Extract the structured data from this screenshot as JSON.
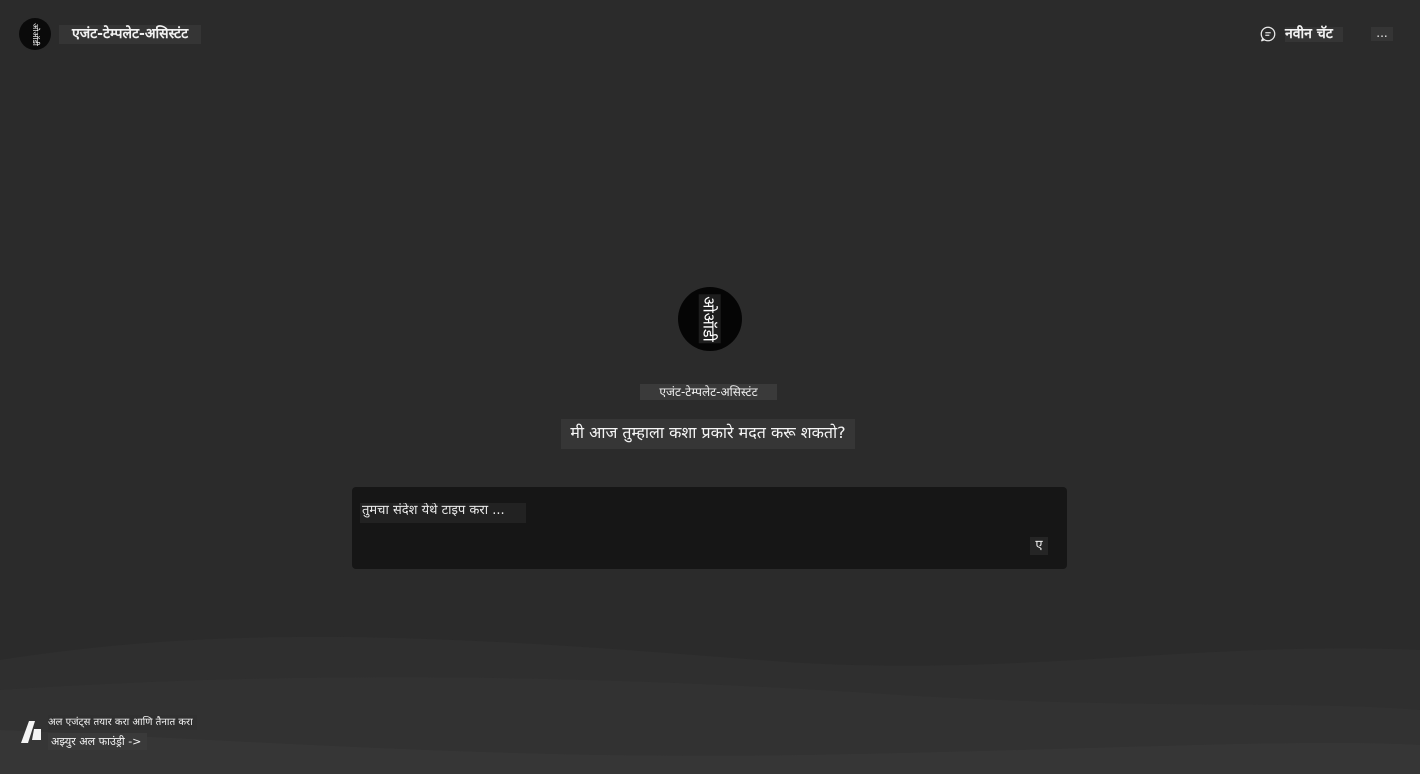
{
  "header": {
    "logo_text": "ओऑडी",
    "app_title": "एजंट-टेम्पलेट-असिस्टंट",
    "new_chat_label": "नवीन चॅट",
    "more_label": "..."
  },
  "hero": {
    "avatar_text": "ओऑडी",
    "agent_name": "एजंट-टेम्पलेट-असिस्टंट",
    "greeting": "मी आज तुम्हाला कशा प्रकारे मदत करू शकतो?"
  },
  "composer": {
    "placeholder": "तुमचा संदेश येथे टाइप करा ...",
    "value": "",
    "send_label": "ए"
  },
  "footer": {
    "tagline": "अल एजंट्स तयार करा आणि तैनात करा",
    "link_label": "अझ्युर अल फाउंड्री ->"
  },
  "colors": {
    "background": "#2b2b2b",
    "composer_bg": "#161616",
    "avatar_bg": "#050505",
    "text": "#f0f0f0"
  },
  "icons": {
    "new_chat": "chat-bubble-icon",
    "brand": "azure-ai-foundry-logo-icon"
  }
}
